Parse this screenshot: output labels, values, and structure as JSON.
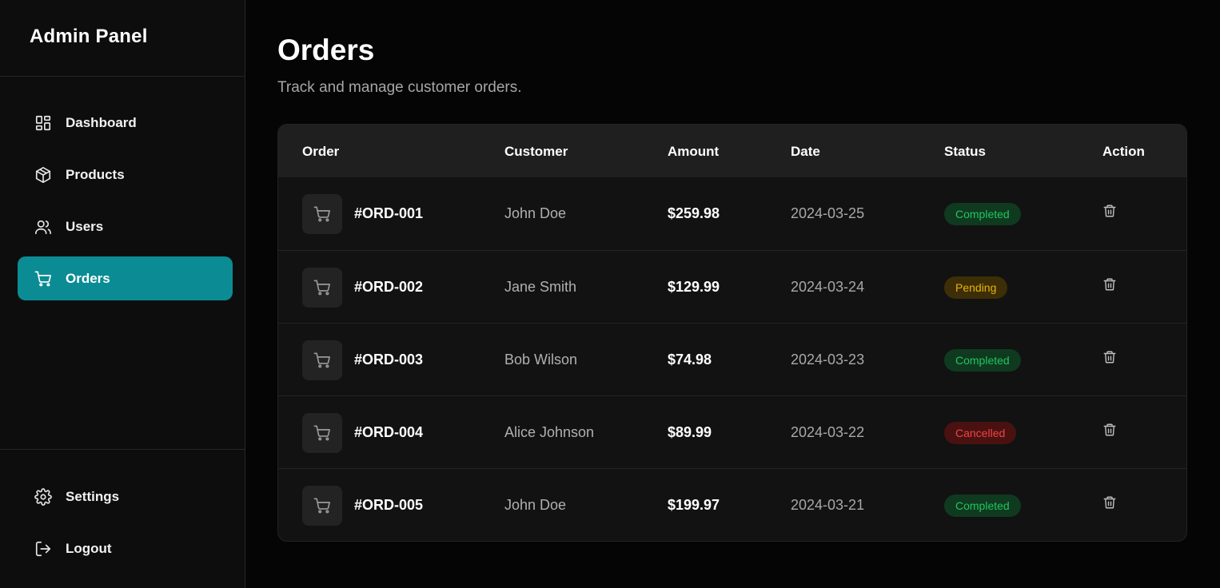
{
  "sidebar": {
    "brand": "Admin Panel",
    "items": [
      {
        "label": "Dashboard",
        "icon": "dashboard-grid-icon"
      },
      {
        "label": "Products",
        "icon": "box-icon"
      },
      {
        "label": "Users",
        "icon": "users-icon"
      },
      {
        "label": "Orders",
        "icon": "cart-icon",
        "active": true
      }
    ],
    "bottom_items": [
      {
        "label": "Settings",
        "icon": "gear-icon"
      },
      {
        "label": "Logout",
        "icon": "logout-icon"
      }
    ]
  },
  "header": {
    "title": "Orders",
    "subtitle": "Track and manage customer orders."
  },
  "table": {
    "columns": [
      "Order",
      "Customer",
      "Amount",
      "Date",
      "Status",
      "Action"
    ],
    "rows": [
      {
        "order": "#ORD-001",
        "customer": "John Doe",
        "amount": "$259.98",
        "date": "2024-03-25",
        "status": "Completed"
      },
      {
        "order": "#ORD-002",
        "customer": "Jane Smith",
        "amount": "$129.99",
        "date": "2024-03-24",
        "status": "Pending"
      },
      {
        "order": "#ORD-003",
        "customer": "Bob Wilson",
        "amount": "$74.98",
        "date": "2024-03-23",
        "status": "Completed"
      },
      {
        "order": "#ORD-004",
        "customer": "Alice Johnson",
        "amount": "$89.99",
        "date": "2024-03-22",
        "status": "Cancelled"
      },
      {
        "order": "#ORD-005",
        "customer": "John Doe",
        "amount": "$199.97",
        "date": "2024-03-21",
        "status": "Completed"
      }
    ]
  },
  "status_colors": {
    "Completed": {
      "bg": "#0f3a20",
      "fg": "#22c55e"
    },
    "Pending": {
      "bg": "#3d2e08",
      "fg": "#eab308"
    },
    "Cancelled": {
      "bg": "#4a1111",
      "fg": "#ef4444"
    }
  },
  "colors": {
    "accent": "#0b8c94",
    "background": "#050505",
    "sidebar": "#0d0d0d"
  }
}
